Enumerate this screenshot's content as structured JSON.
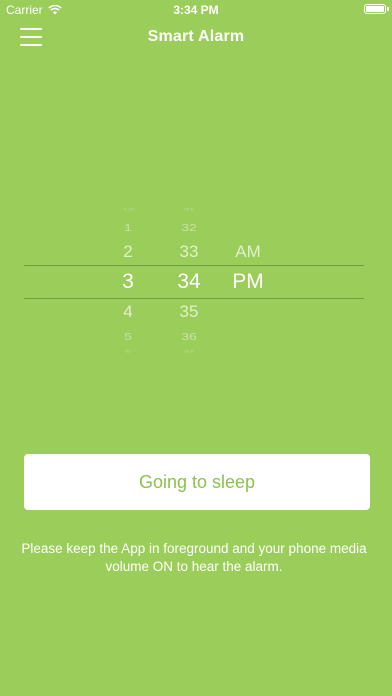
{
  "status_bar": {
    "carrier": "Carrier",
    "time": "3:34 PM",
    "icons": [
      "wifi-icon",
      "battery-icon"
    ]
  },
  "nav": {
    "title": "Smart Alarm",
    "menu_icon": "hamburger-menu-icon"
  },
  "picker": {
    "hours": [
      "12",
      "1",
      "2",
      "3",
      "4",
      "5",
      "6"
    ],
    "minutes": [
      "31",
      "32",
      "33",
      "34",
      "35",
      "36",
      "37"
    ],
    "periods": [
      "AM",
      "PM"
    ],
    "selected": {
      "hour": "3",
      "minute": "34",
      "period": "PM"
    }
  },
  "cta": {
    "label": "Going to sleep"
  },
  "notice": {
    "text": "Please keep the App in foreground and your phone media volume ON to hear the alarm."
  },
  "colors": {
    "background": "#9acd5a",
    "button_text": "#8bc34a",
    "text": "#ffffff"
  }
}
